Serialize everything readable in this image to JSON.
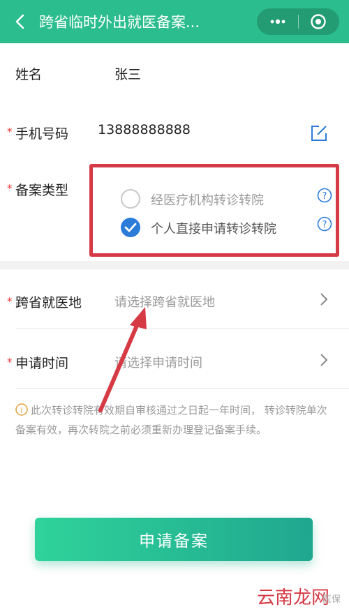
{
  "header": {
    "title": "跨省临时外出就医备案..."
  },
  "form": {
    "name": {
      "label": "姓名",
      "value": "张三"
    },
    "phone": {
      "required": "*",
      "label": "手机号码",
      "value": "13888888888"
    },
    "record_type": {
      "required": "*",
      "label": "备案类型",
      "options": [
        {
          "label": "经医疗机构转诊转院",
          "checked": false
        },
        {
          "label": "个人直接申请转诊转院",
          "checked": true
        }
      ]
    },
    "location": {
      "required": "*",
      "label": "跨省就医地",
      "placeholder": "请选择跨省就医地"
    },
    "time": {
      "required": "*",
      "label": "申请时间",
      "placeholder": "请选择申请时间"
    }
  },
  "notice": "此次转诊转院有效期自审核通过之日起一年时间， 转诊转院单次备案有效，再次转院之前必须重新办理登记备案手续。",
  "submit_label": "申请备案",
  "watermark": {
    "main": "云南龙网",
    "small": "医保"
  },
  "colors": {
    "header": "#2bbd8d",
    "checked": "#2b7bd9",
    "highlight": "#d63a45",
    "button_start": "#2fd39a",
    "button_end": "#20a78f"
  }
}
